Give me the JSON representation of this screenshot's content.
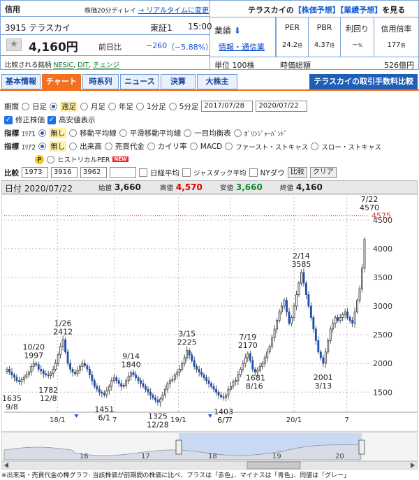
{
  "header": {
    "market_label": "信用",
    "delay_note": "株価20分ディレイ",
    "realtime_link": "→ リアルタイムに変更",
    "forecast_prefix": "テラスカイの",
    "forecast_stock": "【株価予想】",
    "forecast_perf": "【業績予想】",
    "forecast_suffix": "を見る",
    "code_name": "3915 テラスカイ",
    "exchange": "東証1",
    "time": "15:00",
    "price": "4,160円",
    "change_label": "前日比",
    "change": "−260",
    "change_pct": "（−5.88%）",
    "compare_label": "比較される銘柄",
    "compare_links": [
      "NESIC",
      "DIT",
      "チェンジ"
    ],
    "perf_label": "業績",
    "perf_link": "情報・通信業",
    "unit": "単位 100株",
    "metrics": [
      {
        "label": "PER",
        "value": "24.2",
        "unit": "倍"
      },
      {
        "label": "PBR",
        "value": "4.37",
        "unit": "倍"
      },
      {
        "label": "利回り",
        "value": "−",
        "unit": "%"
      },
      {
        "label": "信用倍率",
        "value": "177",
        "unit": "倍"
      }
    ],
    "market_cap_label": "時価総額",
    "market_cap": "526億円"
  },
  "tabs": [
    "基本情報",
    "チャート",
    "時系列",
    "ニュース",
    "決算",
    "大株主"
  ],
  "fee_banner": "テラスカイの取引手数料比較",
  "controls": {
    "period_label": "期間",
    "periods": [
      "日足",
      "週足",
      "月足",
      "年足",
      "1分足",
      "5分足"
    ],
    "date_from": "2017/07/28",
    "date_to": "2020/07/22",
    "adjusted": "修正株価",
    "high_low": "高安値表示",
    "ind_label": "指標",
    "area1": "ｴﾘｱ1",
    "area1_opts": [
      "無し",
      "移動平均線",
      "平滑移動平均線",
      "一目均衡表",
      "ﾎﾞﾘﾝｼﾞｬｰﾊﾞﾝﾄﾞ"
    ],
    "area2": "ｴﾘｱ2",
    "area2_opts": [
      "無し",
      "出来高",
      "売買代金",
      "カイリ率",
      "MACD",
      "ファースト・ストキャス",
      "スロー・ストキャス"
    ],
    "hist_per": "ヒストリカルPER",
    "new_badge": "NEW",
    "compare_label": "比較",
    "compare_codes": [
      "1973",
      "3916",
      "3962",
      ""
    ],
    "nikkei": "日経平均",
    "jasdaq": "ジャスダック平均",
    "nydow": "NYダウ",
    "compare_btn": "比較",
    "clear_btn": "クリア"
  },
  "ohlc": {
    "date_label": "日付",
    "date": "2020/07/22",
    "open_label": "始値",
    "open": "3,660",
    "high_label": "高値",
    "high": "4,570",
    "low_label": "安値",
    "low": "3,660",
    "close_label": "終値",
    "close": "4,160"
  },
  "chart_data": {
    "type": "candlestick",
    "ylim": [
      1150,
      4900
    ],
    "yticks": [
      1500,
      2000,
      2500,
      3000,
      3500,
      4000,
      4500
    ],
    "current_marker": 4575,
    "xticks": [
      "18/1",
      "7",
      "19/1",
      "7",
      "20/1",
      "7"
    ],
    "close_series": [
      1900,
      1850,
      1800,
      1760,
      1700,
      1680,
      1720,
      1760,
      1800,
      1850,
      1950,
      2000,
      1980,
      1900,
      1870,
      1820,
      1800,
      1790,
      1830,
      1900,
      2000,
      2150,
      2300,
      2412,
      2200,
      2000,
      1900,
      1850,
      1820,
      1880,
      1950,
      2000,
      1960,
      1900,
      1800,
      1700,
      1600,
      1550,
      1500,
      1480,
      1451,
      1520,
      1600,
      1700,
      1750,
      1700,
      1650,
      1600,
      1620,
      1700,
      1780,
      1840,
      1800,
      1750,
      1700,
      1650,
      1600,
      1550,
      1500,
      1450,
      1400,
      1360,
      1325,
      1380,
      1450,
      1550,
      1650,
      1700,
      1720,
      1800,
      1850,
      1900,
      2000,
      2100,
      2225,
      2150,
      2050,
      1950,
      1900,
      1850,
      1800,
      1750,
      1700,
      1650,
      1600,
      1550,
      1500,
      1450,
      1420,
      1403,
      1450,
      1550,
      1600,
      1681,
      1700,
      1800,
      1900,
      2000,
      2100,
      2170,
      2050,
      1900,
      1850,
      1880,
      1950,
      2000,
      2100,
      2200,
      2300,
      2450,
      2600,
      2750,
      2900,
      3000,
      3100,
      2900,
      2700,
      2800,
      3000,
      3200,
      3400,
      3585,
      3400,
      3200,
      3000,
      2800,
      2600,
      2400,
      2200,
      2100,
      2001,
      2200,
      2400,
      2600,
      2700,
      2800,
      2750,
      2800,
      2850,
      2900,
      2800,
      2750,
      2700,
      2900,
      3100,
      3300,
      3660,
      4160
    ],
    "annotations": [
      {
        "label": "1635\n9/8",
        "i": 2,
        "v": 1635,
        "pos": "below"
      },
      {
        "label": "10/20\n1997",
        "i": 11,
        "v": 1997,
        "pos": "above"
      },
      {
        "label": "1782\n12/8",
        "i": 17,
        "v": 1782,
        "pos": "below"
      },
      {
        "label": "1/26\n2412",
        "i": 23,
        "v": 2412,
        "pos": "above"
      },
      {
        "label": "1451\n6/1",
        "i": 40,
        "v": 1451,
        "pos": "below"
      },
      {
        "label": "9/14\n1840",
        "i": 51,
        "v": 1840,
        "pos": "above"
      },
      {
        "label": "1325\n12/28",
        "i": 62,
        "v": 1325,
        "pos": "below"
      },
      {
        "label": "3/15\n2225",
        "i": 74,
        "v": 2225,
        "pos": "above"
      },
      {
        "label": "1403\n6/7",
        "i": 89,
        "v": 1403,
        "pos": "below"
      },
      {
        "label": "1681\n8/16",
        "i": 93,
        "v": 1681,
        "pos": "right"
      },
      {
        "label": "7/19\n2170",
        "i": 99,
        "v": 2170,
        "pos": "above"
      },
      {
        "label": "2/14\n3585",
        "i": 121,
        "v": 3585,
        "pos": "above"
      },
      {
        "label": "2001\n3/13",
        "i": 130,
        "v": 2001,
        "pos": "below"
      },
      {
        "label": "7/22\n4570",
        "i": 149,
        "v": 4570,
        "pos": "above"
      }
    ]
  },
  "navigator": {
    "labels": [
      "16",
      "17",
      "18",
      "19",
      "20"
    ]
  },
  "footnote": "※出来高・売買代金の棒グラフ: 当該株価が前期間の株価に比べ、プラスは「赤色」、マイナスは「青色」、同値は「グレー」"
}
